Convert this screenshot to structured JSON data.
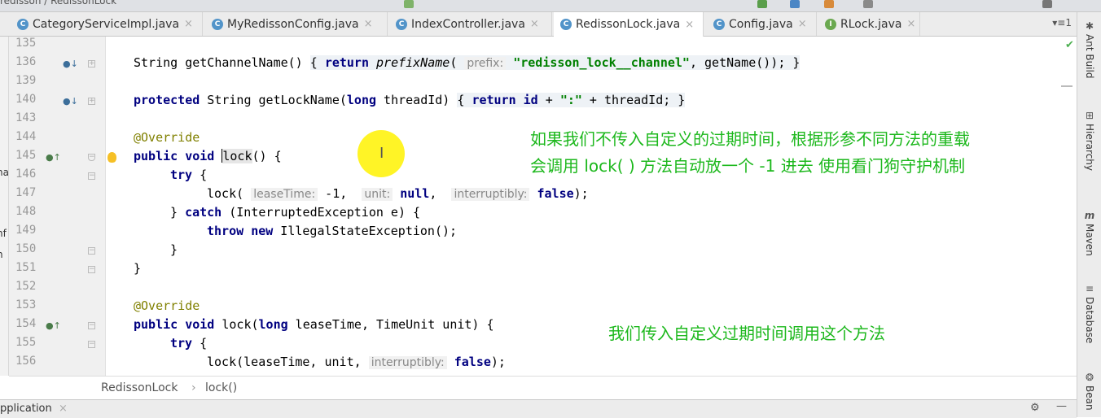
{
  "window": {
    "crumb": "redisson / RedissonLock"
  },
  "tabs": [
    {
      "label": "CategoryServiceImpl.java",
      "icon": "C",
      "active": false
    },
    {
      "label": "MyRedissonConfig.java",
      "icon": "C",
      "active": false
    },
    {
      "label": "IndexController.java",
      "icon": "C",
      "active": false
    },
    {
      "label": "RedissonLock.java",
      "icon": "C",
      "active": true
    },
    {
      "label": "Config.java",
      "icon": "C",
      "active": false
    },
    {
      "label": "RLock.java",
      "icon": "I",
      "active": false
    }
  ],
  "tab_menu": "▾≡1",
  "left_strip": {
    "a": "na",
    "b": "nf",
    "c": "n"
  },
  "lines": [
    "135",
    "136",
    "139",
    "140",
    "143",
    "144",
    "145",
    "146",
    "147",
    "148",
    "149",
    "150",
    "151",
    "152",
    "153",
    "154",
    "155",
    "156"
  ],
  "code": {
    "l136": {
      "t1": "String getChannelName() ",
      "k_return": "return",
      "m": "prefixName",
      "h": "prefix:",
      "s": "\"redisson_lock__channel\"",
      "t2": ", getName()); }"
    },
    "l140": {
      "k_protected": "protected",
      "t1": " String getLockName(",
      "k_long": "long",
      "t2": " threadId) ",
      "k_return": "return",
      "k_id": "id",
      "t3": " + ",
      "s": "\":\"",
      "t4": " + threadId; }"
    },
    "l144": "@Override",
    "l145": {
      "k_public": "public",
      "k_void": "void",
      "name": "lock",
      "rest": "() {"
    },
    "l146": {
      "k_try": "try",
      "rest": " {"
    },
    "l147": {
      "t1": "lock(",
      "h1": "leaseTime:",
      "v1": " -1, ",
      "h2": "unit:",
      "k_null": "null",
      "c1": ", ",
      "h3": "interruptibly:",
      "k_false": "false",
      "t2": ");"
    },
    "l148": {
      "t1": "} ",
      "k_catch": "catch",
      "t2": " (InterruptedException e) {"
    },
    "l149": {
      "k_throw": "throw",
      "k_new": "new",
      "rest": " IllegalStateException();"
    },
    "l150": "}",
    "l151": "}",
    "l153": "@Override",
    "l154": {
      "k_public": "public",
      "k_void": "void",
      "t1": " lock(",
      "k_long": "long",
      "t2": " leaseTime, TimeUnit unit) {"
    },
    "l155": {
      "k_try": "try",
      "rest": " {"
    },
    "l156": {
      "t1": "lock(leaseTime, unit, ",
      "h": "interruptibly:",
      "k_false": "false",
      "t2": ");"
    }
  },
  "notes": {
    "line1": "如果我们不传入自定义的过期时间，根据形参不同方法的重载",
    "line2": "会调用 lock( ) 方法自动放一个 -1 进去 使用看门狗守护机制",
    "line3": "我们传入自定义过期时间调用这个方法"
  },
  "breadcrumb": {
    "cls": "RedissonLock",
    "sep": "›",
    "method": "lock()"
  },
  "bottom": {
    "label": "pplication",
    "close": "×"
  },
  "right_tools": [
    "Ant Build",
    "Hierarchy",
    "Maven",
    "Database",
    "Bean"
  ],
  "colors": {
    "note": "#1db81d",
    "keyword": "#000080",
    "string": "#008000",
    "annotation": "#808000"
  }
}
